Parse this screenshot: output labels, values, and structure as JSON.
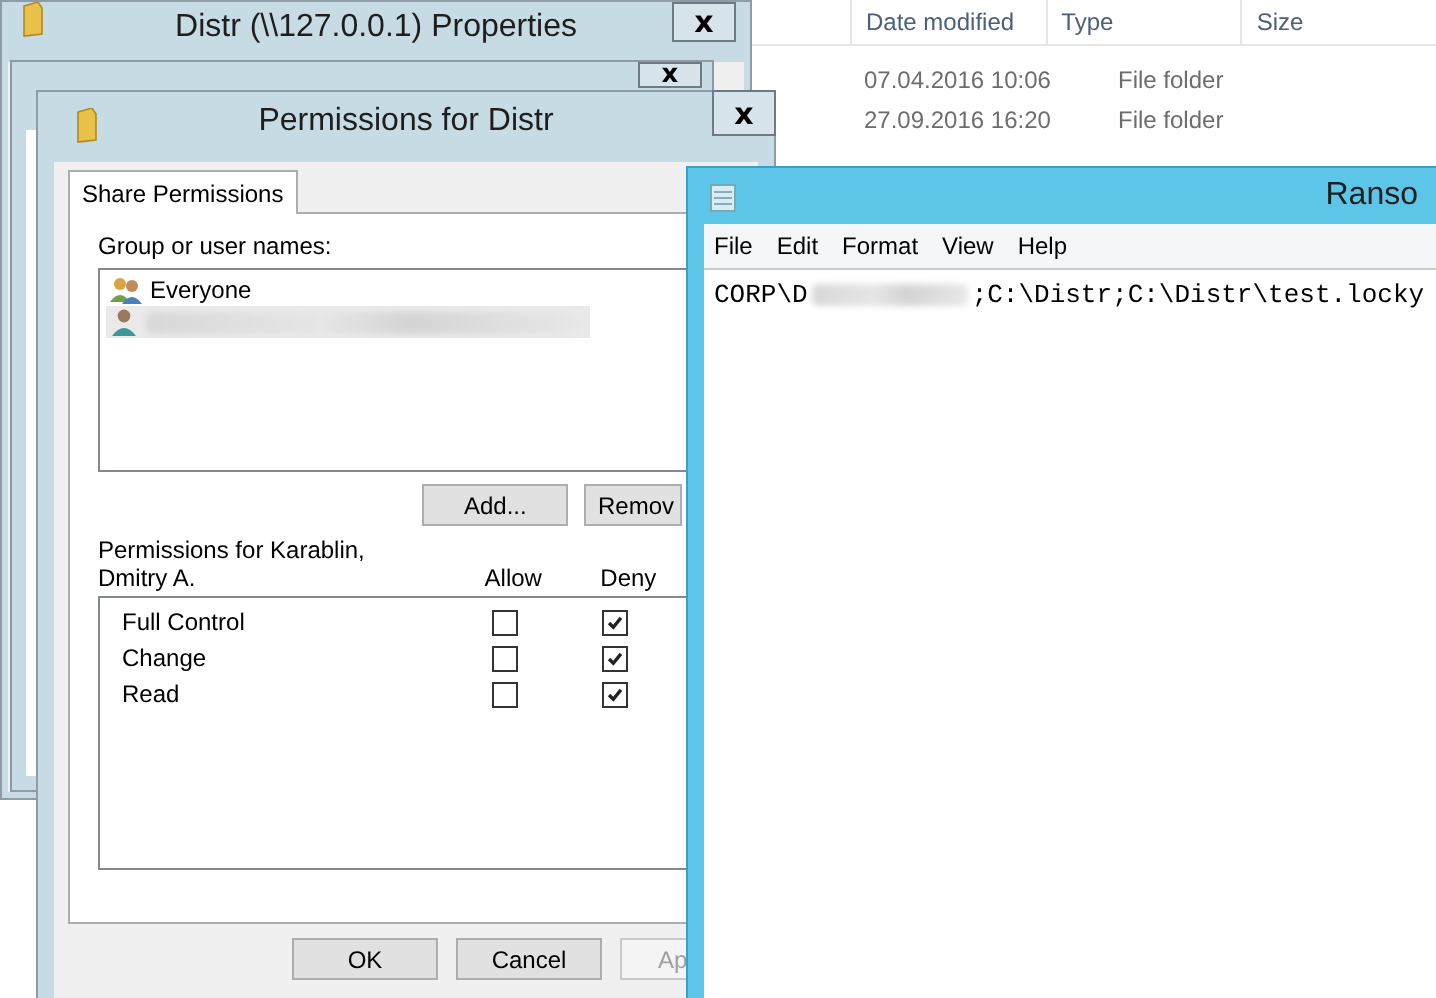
{
  "explorer": {
    "columns": [
      "Date modified",
      "Type",
      "Size"
    ],
    "rows": [
      {
        "date": "07.04.2016 10:06",
        "type": "File folder"
      },
      {
        "date": "27.09.2016 16:20",
        "type": "File folder"
      }
    ]
  },
  "properties_window": {
    "title": "Distr (\\\\127.0.0.1) Properties",
    "close": "x"
  },
  "advanced_sharing_window": {
    "close": "x"
  },
  "permissions_window": {
    "title": "Permissions for Distr",
    "close": "x",
    "tabs": [
      {
        "label": "Share Permissions",
        "selected": true
      }
    ],
    "group_label": "Group or user names:",
    "users": [
      {
        "kind": "group",
        "label": "Everyone",
        "selected": false
      },
      {
        "kind": "user",
        "selected": true
      }
    ],
    "list_buttons": [
      "Add...",
      "Remov"
    ],
    "permissions_label": "Permissions for Karablin, Dmitry A.",
    "permission_columns": [
      "Allow",
      "Deny"
    ],
    "permissions": [
      {
        "name": "Full Control",
        "allow": false,
        "deny": true
      },
      {
        "name": "Change",
        "allow": false,
        "deny": true
      },
      {
        "name": "Read",
        "allow": false,
        "deny": true
      }
    ],
    "buttons": [
      {
        "label": "OK",
        "disabled": false
      },
      {
        "label": "Cancel",
        "disabled": false
      },
      {
        "label": "Ap",
        "disabled": true
      }
    ]
  },
  "notepad": {
    "title": "Ranso",
    "menu": [
      "File",
      "Edit",
      "Format",
      "View",
      "Help"
    ],
    "text_before": "CORP\\D",
    "text_after": ";C:\\Distr;C:\\Distr\\test.locky"
  }
}
